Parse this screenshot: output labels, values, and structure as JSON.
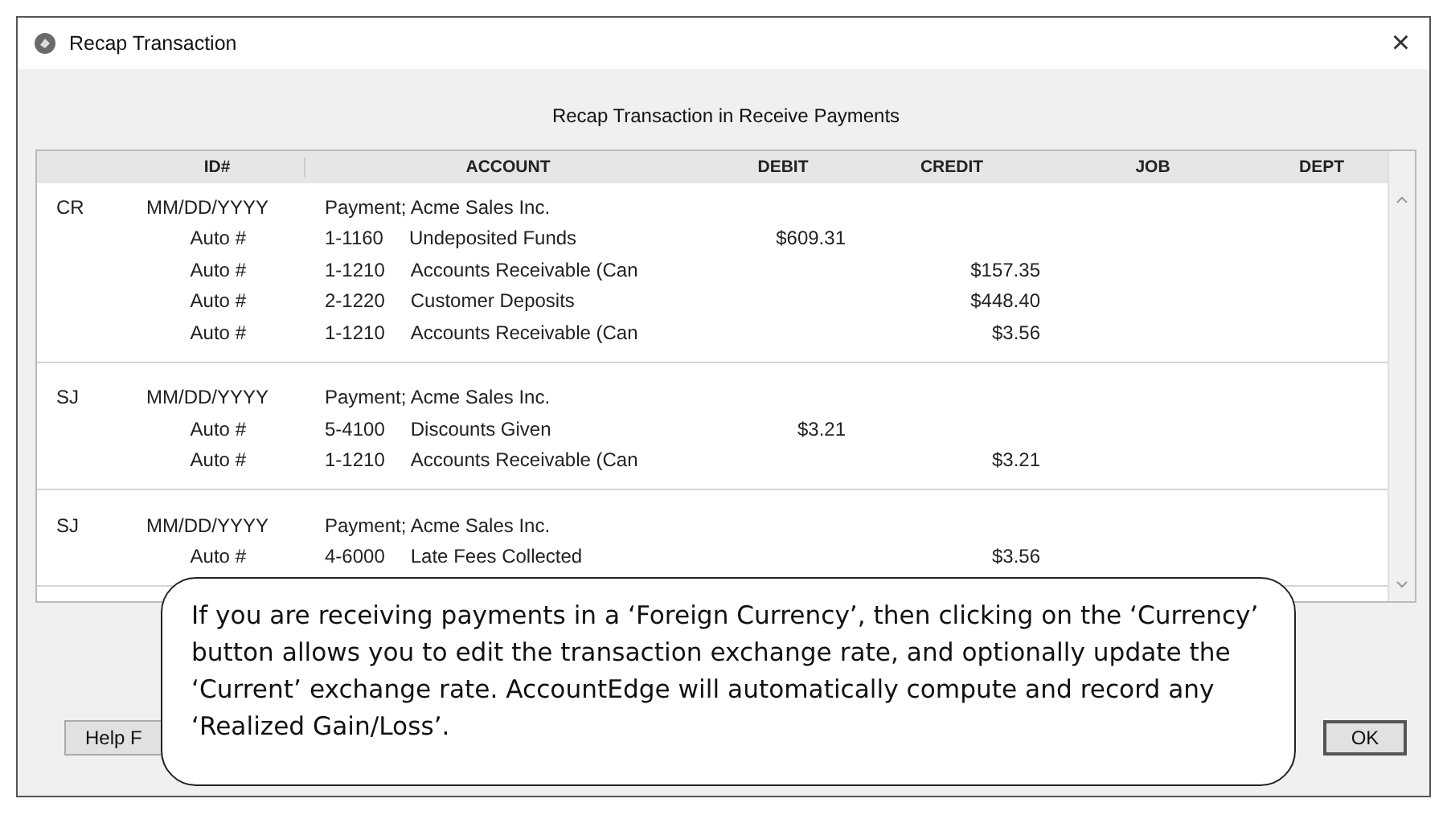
{
  "window": {
    "title": "Recap Transaction",
    "close": "×"
  },
  "heading": "Recap Transaction in Receive Payments",
  "table": {
    "columns": [
      "ID#",
      "ACCOUNT",
      "DEBIT",
      "CREDIT",
      "JOB",
      "DEPT"
    ],
    "groups": [
      {
        "journal": "CR",
        "date": "MM/DD/YYYY",
        "memo": "Payment; Acme Sales Inc.",
        "lines": [
          {
            "id": "Auto #",
            "account_no": "1-1160",
            "account_name": "Undeposited Funds",
            "debit": "$609.31"
          },
          {
            "id": "Auto #",
            "account_no": "1-1210",
            "account_name": "Accounts Receivable (Can",
            "credit": "$157.35"
          },
          {
            "id": "Auto #",
            "account_no": "2-1220",
            "account_name": "Customer Deposits",
            "credit": "$448.40"
          },
          {
            "id": "Auto #",
            "account_no": "1-1210",
            "account_name": "Accounts Receivable (Can",
            "credit": "$3.56"
          }
        ]
      },
      {
        "journal": "SJ",
        "date": "MM/DD/YYYY",
        "memo": "Payment; Acme Sales Inc.",
        "lines": [
          {
            "id": "Auto #",
            "account_no": "5-4100",
            "account_name": "Discounts Given",
            "debit": "$3.21"
          },
          {
            "id": "Auto #",
            "account_no": "1-1210",
            "account_name": "Accounts Receivable (Can",
            "credit": "$3.21"
          }
        ]
      },
      {
        "journal": "SJ",
        "date": "MM/DD/YYYY",
        "memo": "Payment; Acme Sales Inc.",
        "lines": [
          {
            "id": "Auto #",
            "account_no": "4-6000",
            "account_name": "Late Fees Collected",
            "credit": "$3.56"
          }
        ]
      }
    ]
  },
  "buttons": [
    "Help F",
    "OK"
  ],
  "callout": "If you are receiving payments in a ‘Foreign Currency’, then clicking on the ‘Currency’ button allows you to edit the transaction exchange rate, and optionally update the ‘Current’ exchange rate. AccountEdge will automatically compute and record any ‘Realized Gain/Loss’."
}
